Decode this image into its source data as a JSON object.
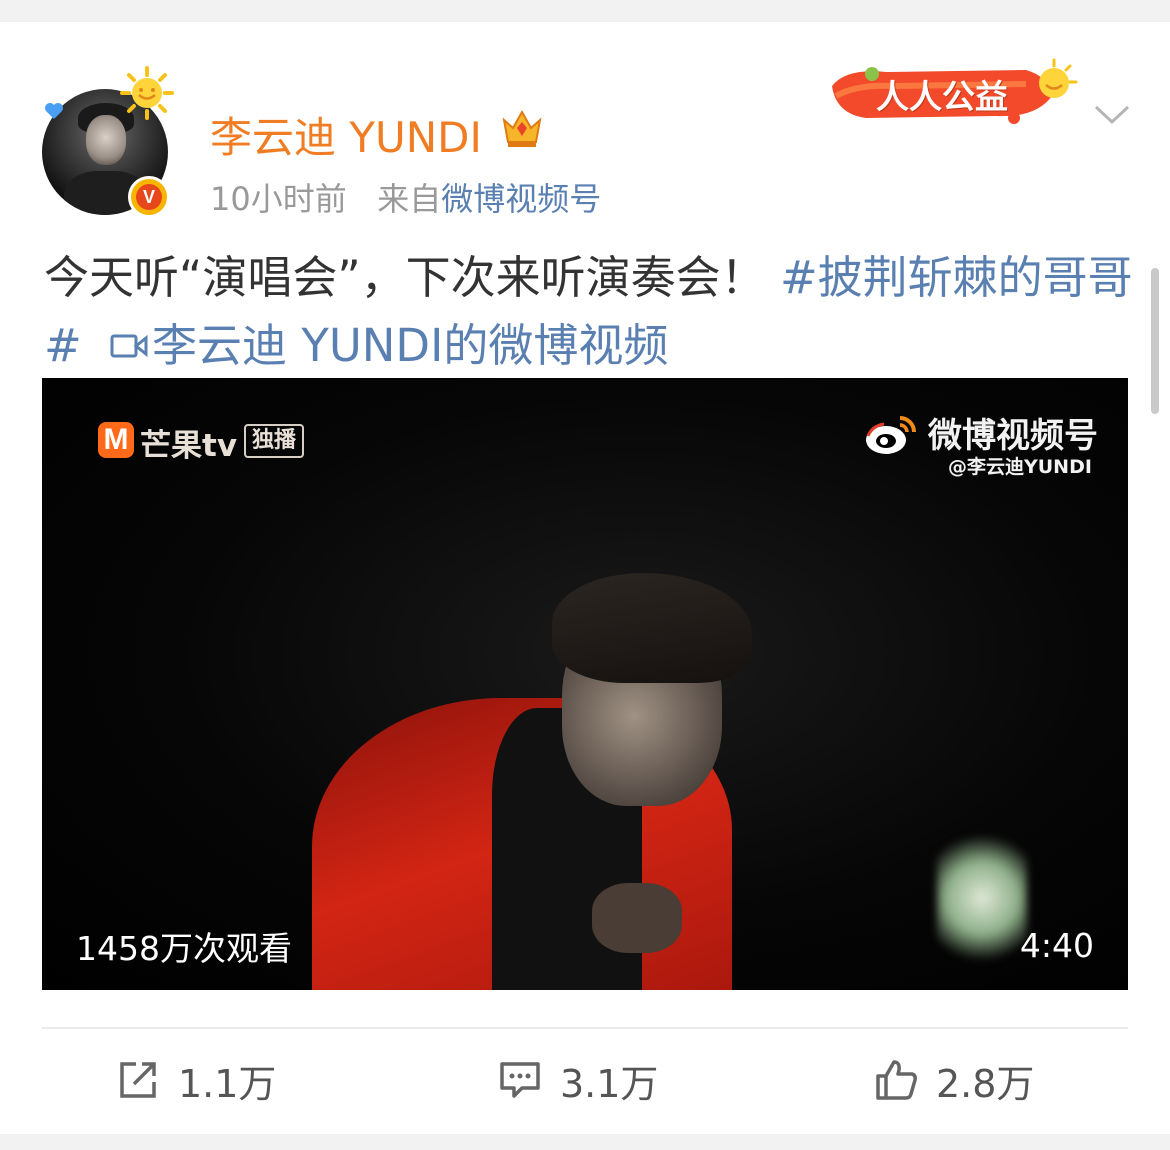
{
  "post": {
    "username": "李云迪 YUNDI",
    "time": "10小时前",
    "source_prefix": "来自",
    "source": "微博视频号",
    "promo_badge": "人人公益",
    "text_main": "今天听“演唱会”，下次来听演奏会！",
    "topic": "#披荆斩棘的哥哥#",
    "video_link": "李云迪 YUNDI的微博视频"
  },
  "video": {
    "watermark_left": "芒果tv",
    "watermark_left_badge": "独播",
    "watermark_right_title": "微博视频号",
    "watermark_right_handle": "@李云迪YUNDI",
    "views": "1458万次观看",
    "duration": "4:40"
  },
  "actions": {
    "repost": "1.1万",
    "comment": "3.1万",
    "like": "2.8万"
  },
  "colors": {
    "username": "#f07d23",
    "link": "#5a7fb1",
    "meta": "#999999",
    "jacket": "#d22514"
  }
}
